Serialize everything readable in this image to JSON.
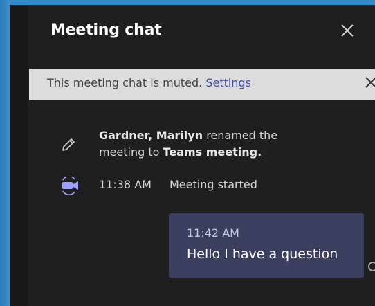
{
  "header": {
    "title": "Meeting chat",
    "close_icon": "close-icon"
  },
  "banner": {
    "text": "This meeting chat is muted.",
    "link": "Settings",
    "close_icon": "close-icon"
  },
  "events": {
    "rename": {
      "icon": "pencil-icon",
      "actor": "Gardner, Marilyn",
      "middle": "renamed the meeting to",
      "new_name": "Teams meeting."
    },
    "meeting_started": {
      "icon": "video-camera-icon",
      "time": "11:38 AM",
      "label": "Meeting started"
    }
  },
  "messages": [
    {
      "time": "11:42 AM",
      "text": "Hello I have a question"
    }
  ],
  "colors": {
    "panel_bg": "#1f1f1f",
    "banner_bg": "#dcdcdc",
    "link": "#464ea8",
    "bubble_bg": "#3b3f5f",
    "accent": "#9ea2ff"
  }
}
